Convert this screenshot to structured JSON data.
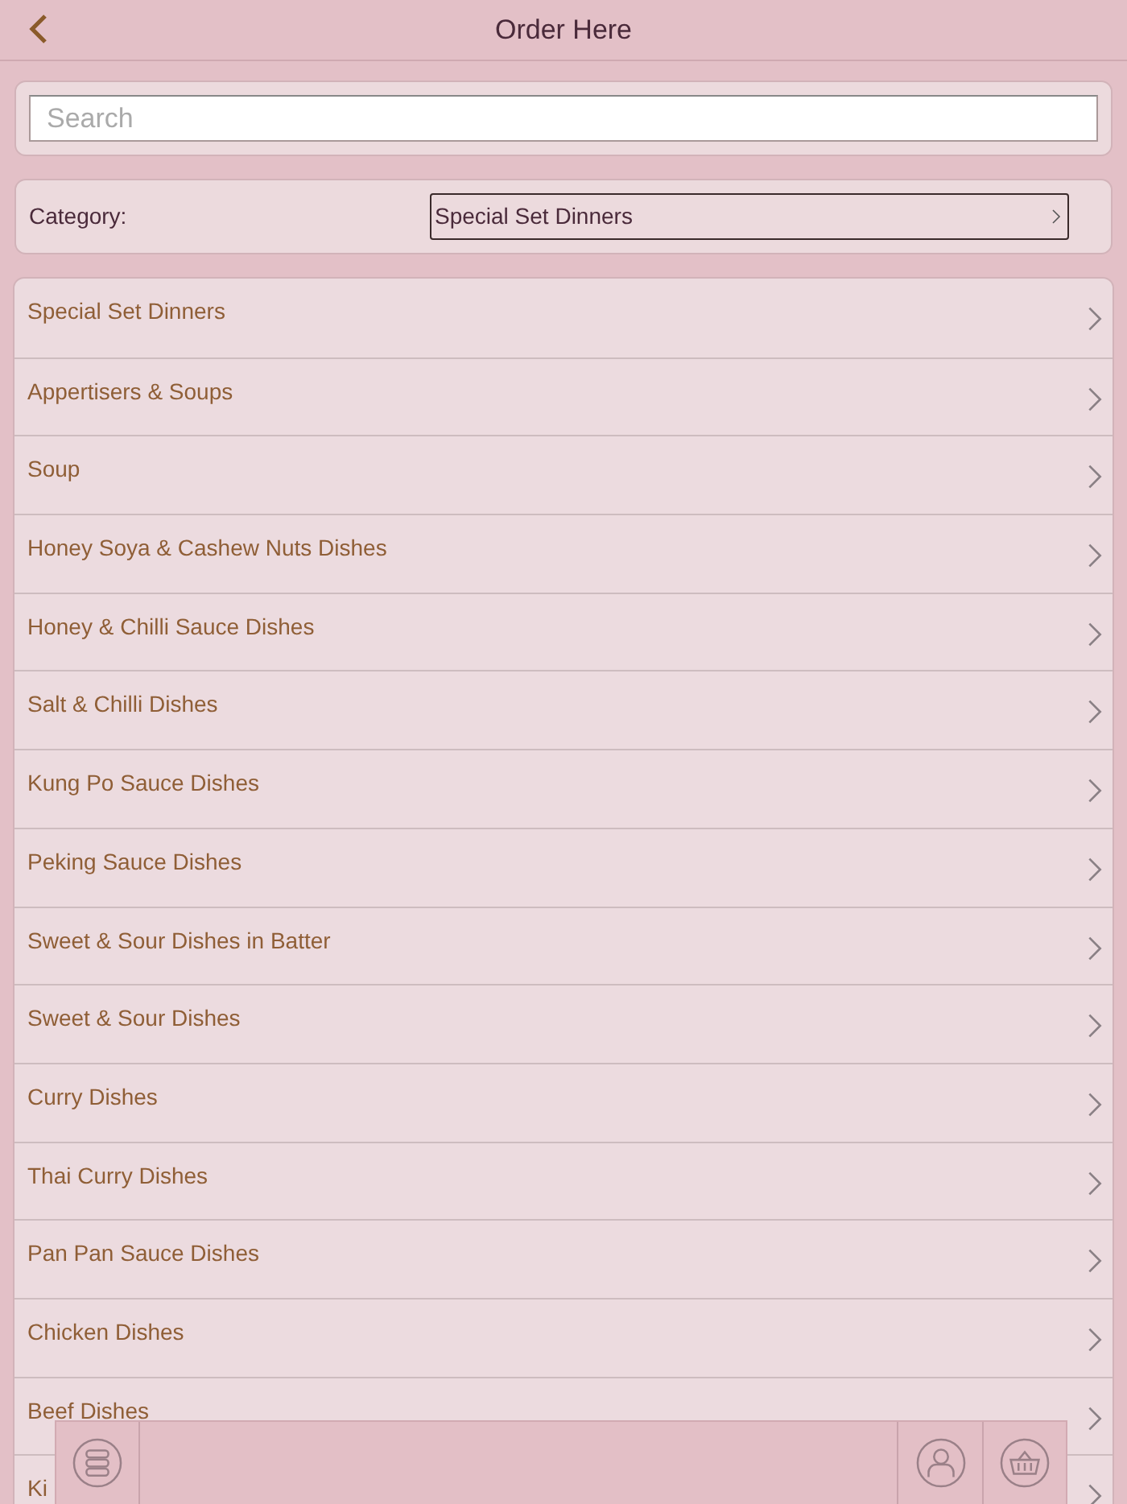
{
  "header": {
    "title": "Order Here"
  },
  "search": {
    "placeholder": "Search"
  },
  "category": {
    "label": "Category:",
    "value": "Special Set Dinners"
  },
  "menu_items": [
    {
      "label": "Special Set Dinners"
    },
    {
      "label": "Appertisers & Soups"
    },
    {
      "label": "Soup"
    },
    {
      "label": "Honey Soya & Cashew Nuts Dishes"
    },
    {
      "label": "Honey & Chilli Sauce Dishes"
    },
    {
      "label": "Salt & Chilli Dishes"
    },
    {
      "label": "Kung Po Sauce Dishes"
    },
    {
      "label": "Peking Sauce Dishes"
    },
    {
      "label": "Sweet & Sour Dishes in Batter"
    },
    {
      "label": "Sweet & Sour Dishes"
    },
    {
      "label": "Curry Dishes"
    },
    {
      "label": "Thai Curry Dishes"
    },
    {
      "label": "Pan Pan Sauce Dishes"
    },
    {
      "label": "Chicken Dishes"
    },
    {
      "label": "Beef Dishes"
    },
    {
      "label": "Ki"
    }
  ]
}
